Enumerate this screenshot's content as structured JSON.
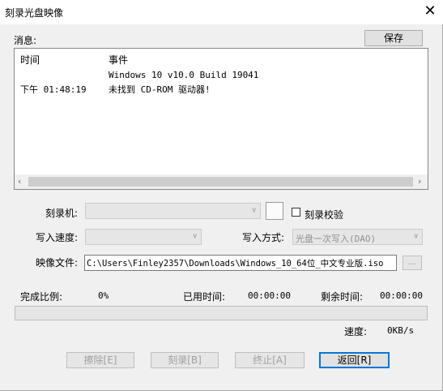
{
  "window": {
    "title": "刻录光盘映像",
    "close_glyph": "✕"
  },
  "log": {
    "label": "消息:",
    "save_button": "保存",
    "columns": [
      "时间",
      "事件"
    ],
    "rows": [
      {
        "time": "",
        "event": "Windows 10 v10.0 Build 19041"
      },
      {
        "time": "下午 01:48:19",
        "event": "未找到 CD-ROM 驱动器!"
      }
    ]
  },
  "form": {
    "burner_label": "刻录机:",
    "verify_label": "刻录校验",
    "verify_checked": false,
    "speed_label": "写入速度:",
    "write_mode_label": "写入方式:",
    "write_mode_value": "光盘一次写入(DAO)",
    "image_label": "映像文件:",
    "image_path": "C:\\Users\\Finley2357\\Downloads\\Windows_10_64位_中文专业版.iso",
    "browse_button": "..."
  },
  "progress": {
    "completion_label": "完成比例:",
    "completion_value": "0%",
    "elapsed_label": "已用时间:",
    "elapsed_value": "00:00:00",
    "remaining_label": "剩余时间:",
    "remaining_value": "00:00:00",
    "fraction": 0,
    "speed_label": "速度:",
    "speed_value": "0KB/s"
  },
  "buttons": {
    "erase": "擦除[E]",
    "burn": "刻录[B]",
    "stop": "终止[A]",
    "back": "返回[R]"
  }
}
